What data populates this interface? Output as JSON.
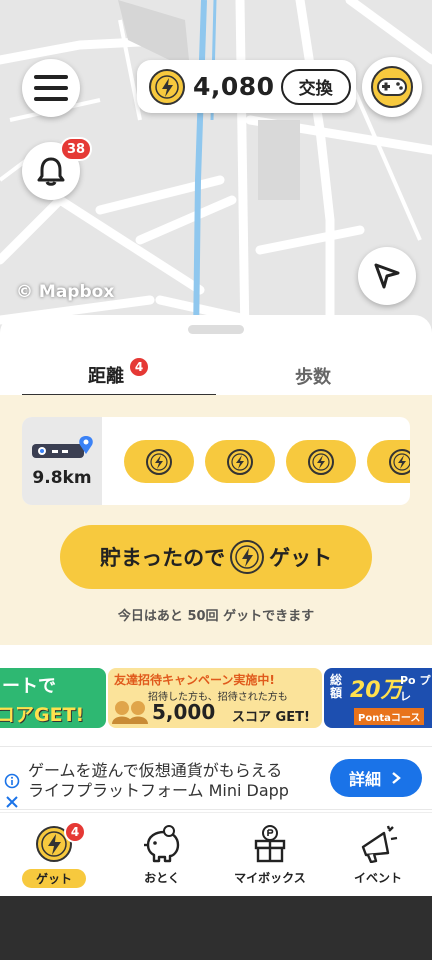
{
  "map": {
    "attribution": "© Mapbox"
  },
  "header": {
    "coin_amount": "4,080",
    "exchange_label": "交換",
    "notification_count": "38"
  },
  "tabs": [
    {
      "label": "距離",
      "badge": "4",
      "active": true
    },
    {
      "label": "歩数",
      "active": false
    }
  ],
  "distance_card": {
    "distance": "9.8km",
    "slots": 4
  },
  "get_button": {
    "pre": "貯まったので",
    "post": "ゲット"
  },
  "remaining_text": "今日はあと 50回 ゲットできます",
  "banners": [
    {
      "line1": "ートで",
      "line2": "コアGET!"
    },
    {
      "line1": "友達招待キャンペーン実施中!",
      "line2": "招待した方も、招待された方も",
      "line3": "5,000",
      "line3b": "スコア GET!"
    },
    {
      "line1": "総額",
      "line2": "20万",
      "line3": "Pontaコース",
      "line4": "Po プレ"
    }
  ],
  "ad": {
    "line1": "ゲームを遊んで仮想通貨がもらえる",
    "line2": "ライフプラットフォーム Mini Dapp",
    "button": "詳細"
  },
  "nav": [
    {
      "label": "ゲット",
      "badge": "4",
      "active": true,
      "icon": "coin-icon"
    },
    {
      "label": "おとく",
      "icon": "piggy-bank-icon"
    },
    {
      "label": "マイボックス",
      "icon": "gift-box-icon"
    },
    {
      "label": "イベント",
      "icon": "megaphone-icon"
    }
  ],
  "colors": {
    "accent": "#f7c93e",
    "badge": "#e53935",
    "ad_button": "#1a73e8",
    "panel_bg": "#faf2dc"
  }
}
